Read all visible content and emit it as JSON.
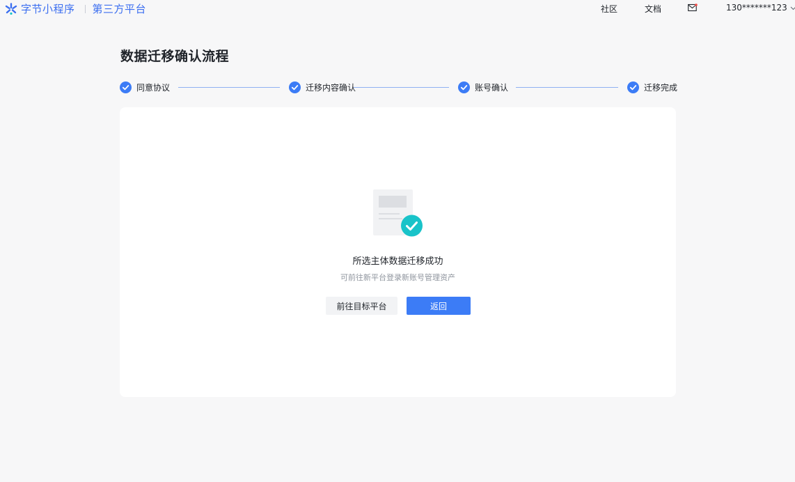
{
  "header": {
    "brand_name": "字节小程序",
    "brand_sub": "第三方平台",
    "brand_color": "#3c6ff0",
    "nav": {
      "community": "社区",
      "docs": "文档",
      "account": "130*******123"
    },
    "icons": {
      "logo": "bytedance-star-icon",
      "mail": "mail-icon",
      "chevron": "chevron-down-icon"
    }
  },
  "page": {
    "title": "数据迁移确认流程"
  },
  "steps": [
    {
      "label": "同意协议",
      "status": "done"
    },
    {
      "label": "迁移内容确认",
      "status": "done"
    },
    {
      "label": "账号确认",
      "status": "done"
    },
    {
      "label": "迁移完成",
      "status": "done"
    }
  ],
  "result": {
    "title": "所选主体数据迁移成功",
    "description": "可前往新平台登录新账号管理资产",
    "secondary_button": "前往目标平台",
    "primary_button": "返回",
    "icon": "document-success-icon",
    "accent_color": "#3c7cf6",
    "success_color": "#19c3c9"
  }
}
